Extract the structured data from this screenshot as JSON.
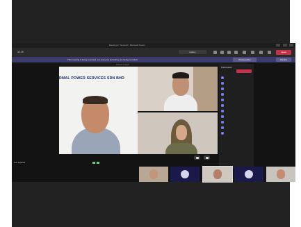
{
  "titlebar": {
    "title": "Meeting in \"General\" | Microsoft Teams"
  },
  "toolbar": {
    "timer": "32:15",
    "tag": "Gallery",
    "leave_label": "Leave"
  },
  "banner": {
    "text": "This meeting is being recorded. Let everyone know they are being recorded.",
    "pills": [
      "Privacy policy",
      "Dismiss"
    ]
  },
  "subbar": {
    "text": "Shared content"
  },
  "share": {
    "caption": "RMAL POWER SERVICES SDN BHD"
  },
  "panel": {
    "header": "Participants",
    "rows": [
      "",
      "",
      "",
      "",
      "",
      "",
      "",
      "",
      "",
      "",
      ""
    ]
  },
  "caption": {
    "text": "Live captions"
  },
  "colors": {
    "banner": "#3d3b6b",
    "leave": "#c4314b",
    "accent": "#7b83eb"
  }
}
